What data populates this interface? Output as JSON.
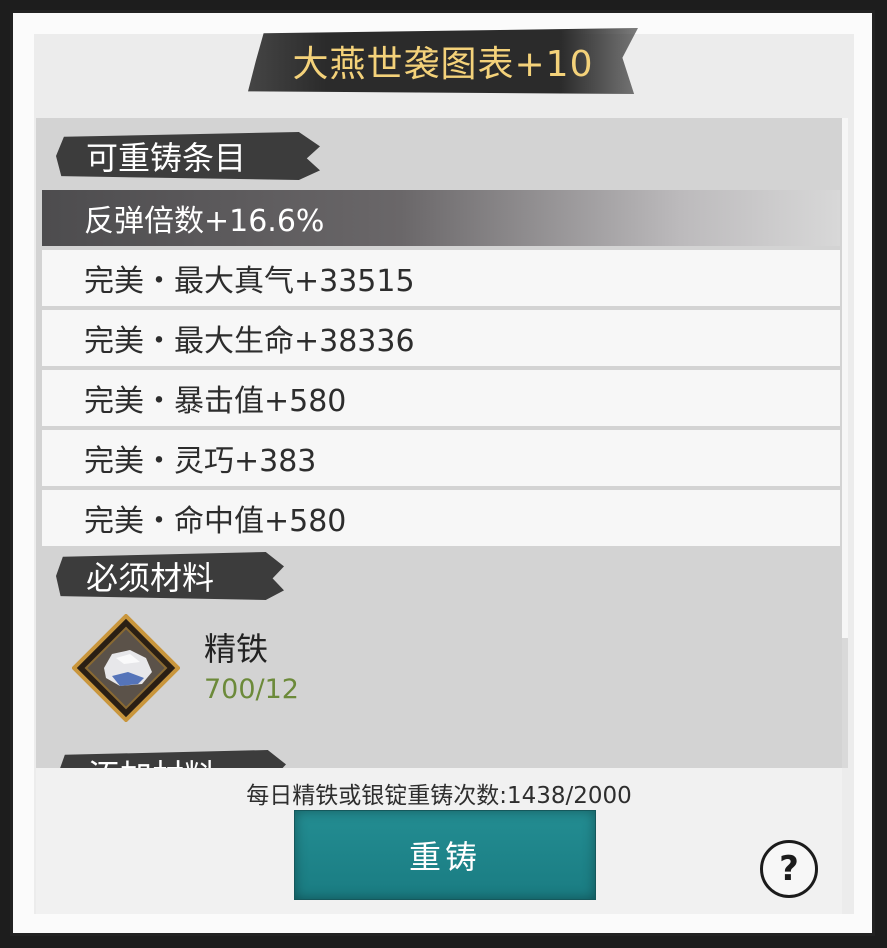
{
  "title": "大燕世袭图表+10",
  "reforge_section": {
    "header": "可重铸条目",
    "items": [
      {
        "label": "反弹倍数+16.6%",
        "selected": true
      },
      {
        "label": "完美・最大真气+33515",
        "selected": false
      },
      {
        "label": "完美・最大生命+38336",
        "selected": false
      },
      {
        "label": "完美・暴击值+580",
        "selected": false
      },
      {
        "label": "完美・灵巧+383",
        "selected": false
      },
      {
        "label": "完美・命中值+580",
        "selected": false
      }
    ]
  },
  "required_materials": {
    "header": "必须材料",
    "item": {
      "name": "精铁",
      "count": "700/12",
      "icon": "iron-ore-icon"
    }
  },
  "add_materials": {
    "header": "添加材料"
  },
  "daily_limit_text": "每日精铁或银锭重铸次数:1438/2000",
  "reforge_button": "重铸",
  "help_icon": "?",
  "colors": {
    "title": "#f4d27a",
    "button": "#1f8489",
    "count": "#6c8a3a"
  }
}
